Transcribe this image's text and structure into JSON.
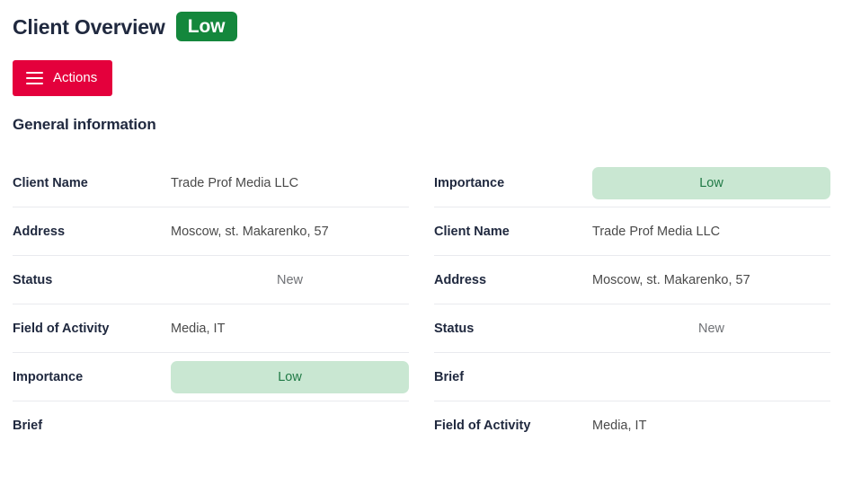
{
  "header": {
    "title": "Client Overview",
    "badge_label": "Low",
    "badge_color": "#14873c"
  },
  "toolbar": {
    "actions_label": "Actions",
    "actions_icon": "hamburger-menu-icon",
    "actions_color": "#e4003c"
  },
  "section": {
    "heading": "General information"
  },
  "colors": {
    "badge_bg": "#c9e7d2",
    "badge_text": "#207a46",
    "label_text": "#20293f",
    "value_text": "#4a4a4a",
    "divider": "#e9eaee"
  },
  "left_column": {
    "rows": [
      {
        "label": "Client Name",
        "value": "Trade Prof Media LLC",
        "type": "text"
      },
      {
        "label": "Address",
        "value": "Moscow, st. Makarenko, 57",
        "type": "text"
      },
      {
        "label": "Status",
        "value": "New",
        "type": "centered"
      },
      {
        "label": "Field of Activity",
        "value": "Media, IT",
        "type": "text"
      },
      {
        "label": "Importance",
        "value": "Low",
        "type": "pill"
      },
      {
        "label": "Brief",
        "value": "",
        "type": "empty"
      }
    ]
  },
  "right_column": {
    "rows": [
      {
        "label": "Importance",
        "value": "Low",
        "type": "pill"
      },
      {
        "label": "Client Name",
        "value": "Trade Prof Media LLC",
        "type": "text"
      },
      {
        "label": "Address",
        "value": "Moscow, st. Makarenko, 57",
        "type": "text"
      },
      {
        "label": "Status",
        "value": "New",
        "type": "centered"
      },
      {
        "label": "Brief",
        "value": "",
        "type": "empty"
      },
      {
        "label": "Field of Activity",
        "value": "Media, IT",
        "type": "text"
      }
    ]
  }
}
